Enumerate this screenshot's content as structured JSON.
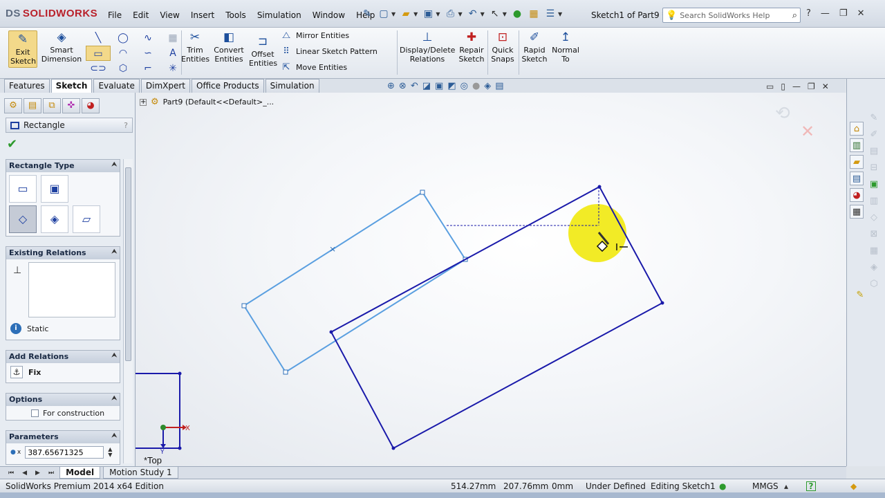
{
  "app": {
    "logo_prefix": "DS",
    "logo": "SOLIDWORKS",
    "document_title": "Sketch1 of Part9 *"
  },
  "menu": [
    "File",
    "Edit",
    "View",
    "Insert",
    "Tools",
    "Simulation",
    "Window",
    "Help"
  ],
  "help_search": {
    "placeholder": "Search SolidWorks Help"
  },
  "command_manager": {
    "exit_sketch": "Exit Sketch",
    "smart_dimension": "Smart Dimension",
    "trim_entities": "Trim Entities",
    "convert_entities": "Convert Entities",
    "offset_entities": "Offset Entities",
    "mirror_entities": "Mirror Entities",
    "linear_sketch_pattern": "Linear Sketch Pattern",
    "move_entities": "Move Entities",
    "display_delete_relations": "Display/Delete Relations",
    "repair_sketch": "Repair Sketch",
    "quick_snaps": "Quick Snaps",
    "rapid_sketch": "Rapid Sketch",
    "normal_to": "Normal To"
  },
  "tabs": [
    "Features",
    "Sketch",
    "Evaluate",
    "DimXpert",
    "Office Products",
    "Simulation"
  ],
  "active_tab": "Sketch",
  "property_manager": {
    "title": "Rectangle",
    "help": "?",
    "groups": {
      "rectangle_type": "Rectangle Type",
      "existing_relations": "Existing Relations",
      "add_relations": "Add Relations",
      "options": "Options",
      "parameters": "Parameters"
    },
    "relation_status": "Static",
    "fix_label": "Fix",
    "for_construction": "For construction",
    "parameter_x_label": "x",
    "parameter_x_value": "387.65671325"
  },
  "viewport": {
    "tree_root": "Part9  (Default<<Default>_...",
    "view_name": "*Top",
    "axis_x": "X",
    "axis_y": "Y"
  },
  "model_tabs": [
    "Model",
    "Motion Study 1"
  ],
  "status": {
    "edition": "SolidWorks Premium 2014 x64 Edition",
    "x": "514.27mm",
    "y": "207.76mm",
    "z": "0mm",
    "state": "Under Defined",
    "editing": "Editing Sketch1",
    "units": "MMGS",
    "help": "?"
  },
  "colors": {
    "preview_rect": "#5a9fe0",
    "sketch_rect": "#1a1aaa",
    "highlight": "#f0e800"
  }
}
